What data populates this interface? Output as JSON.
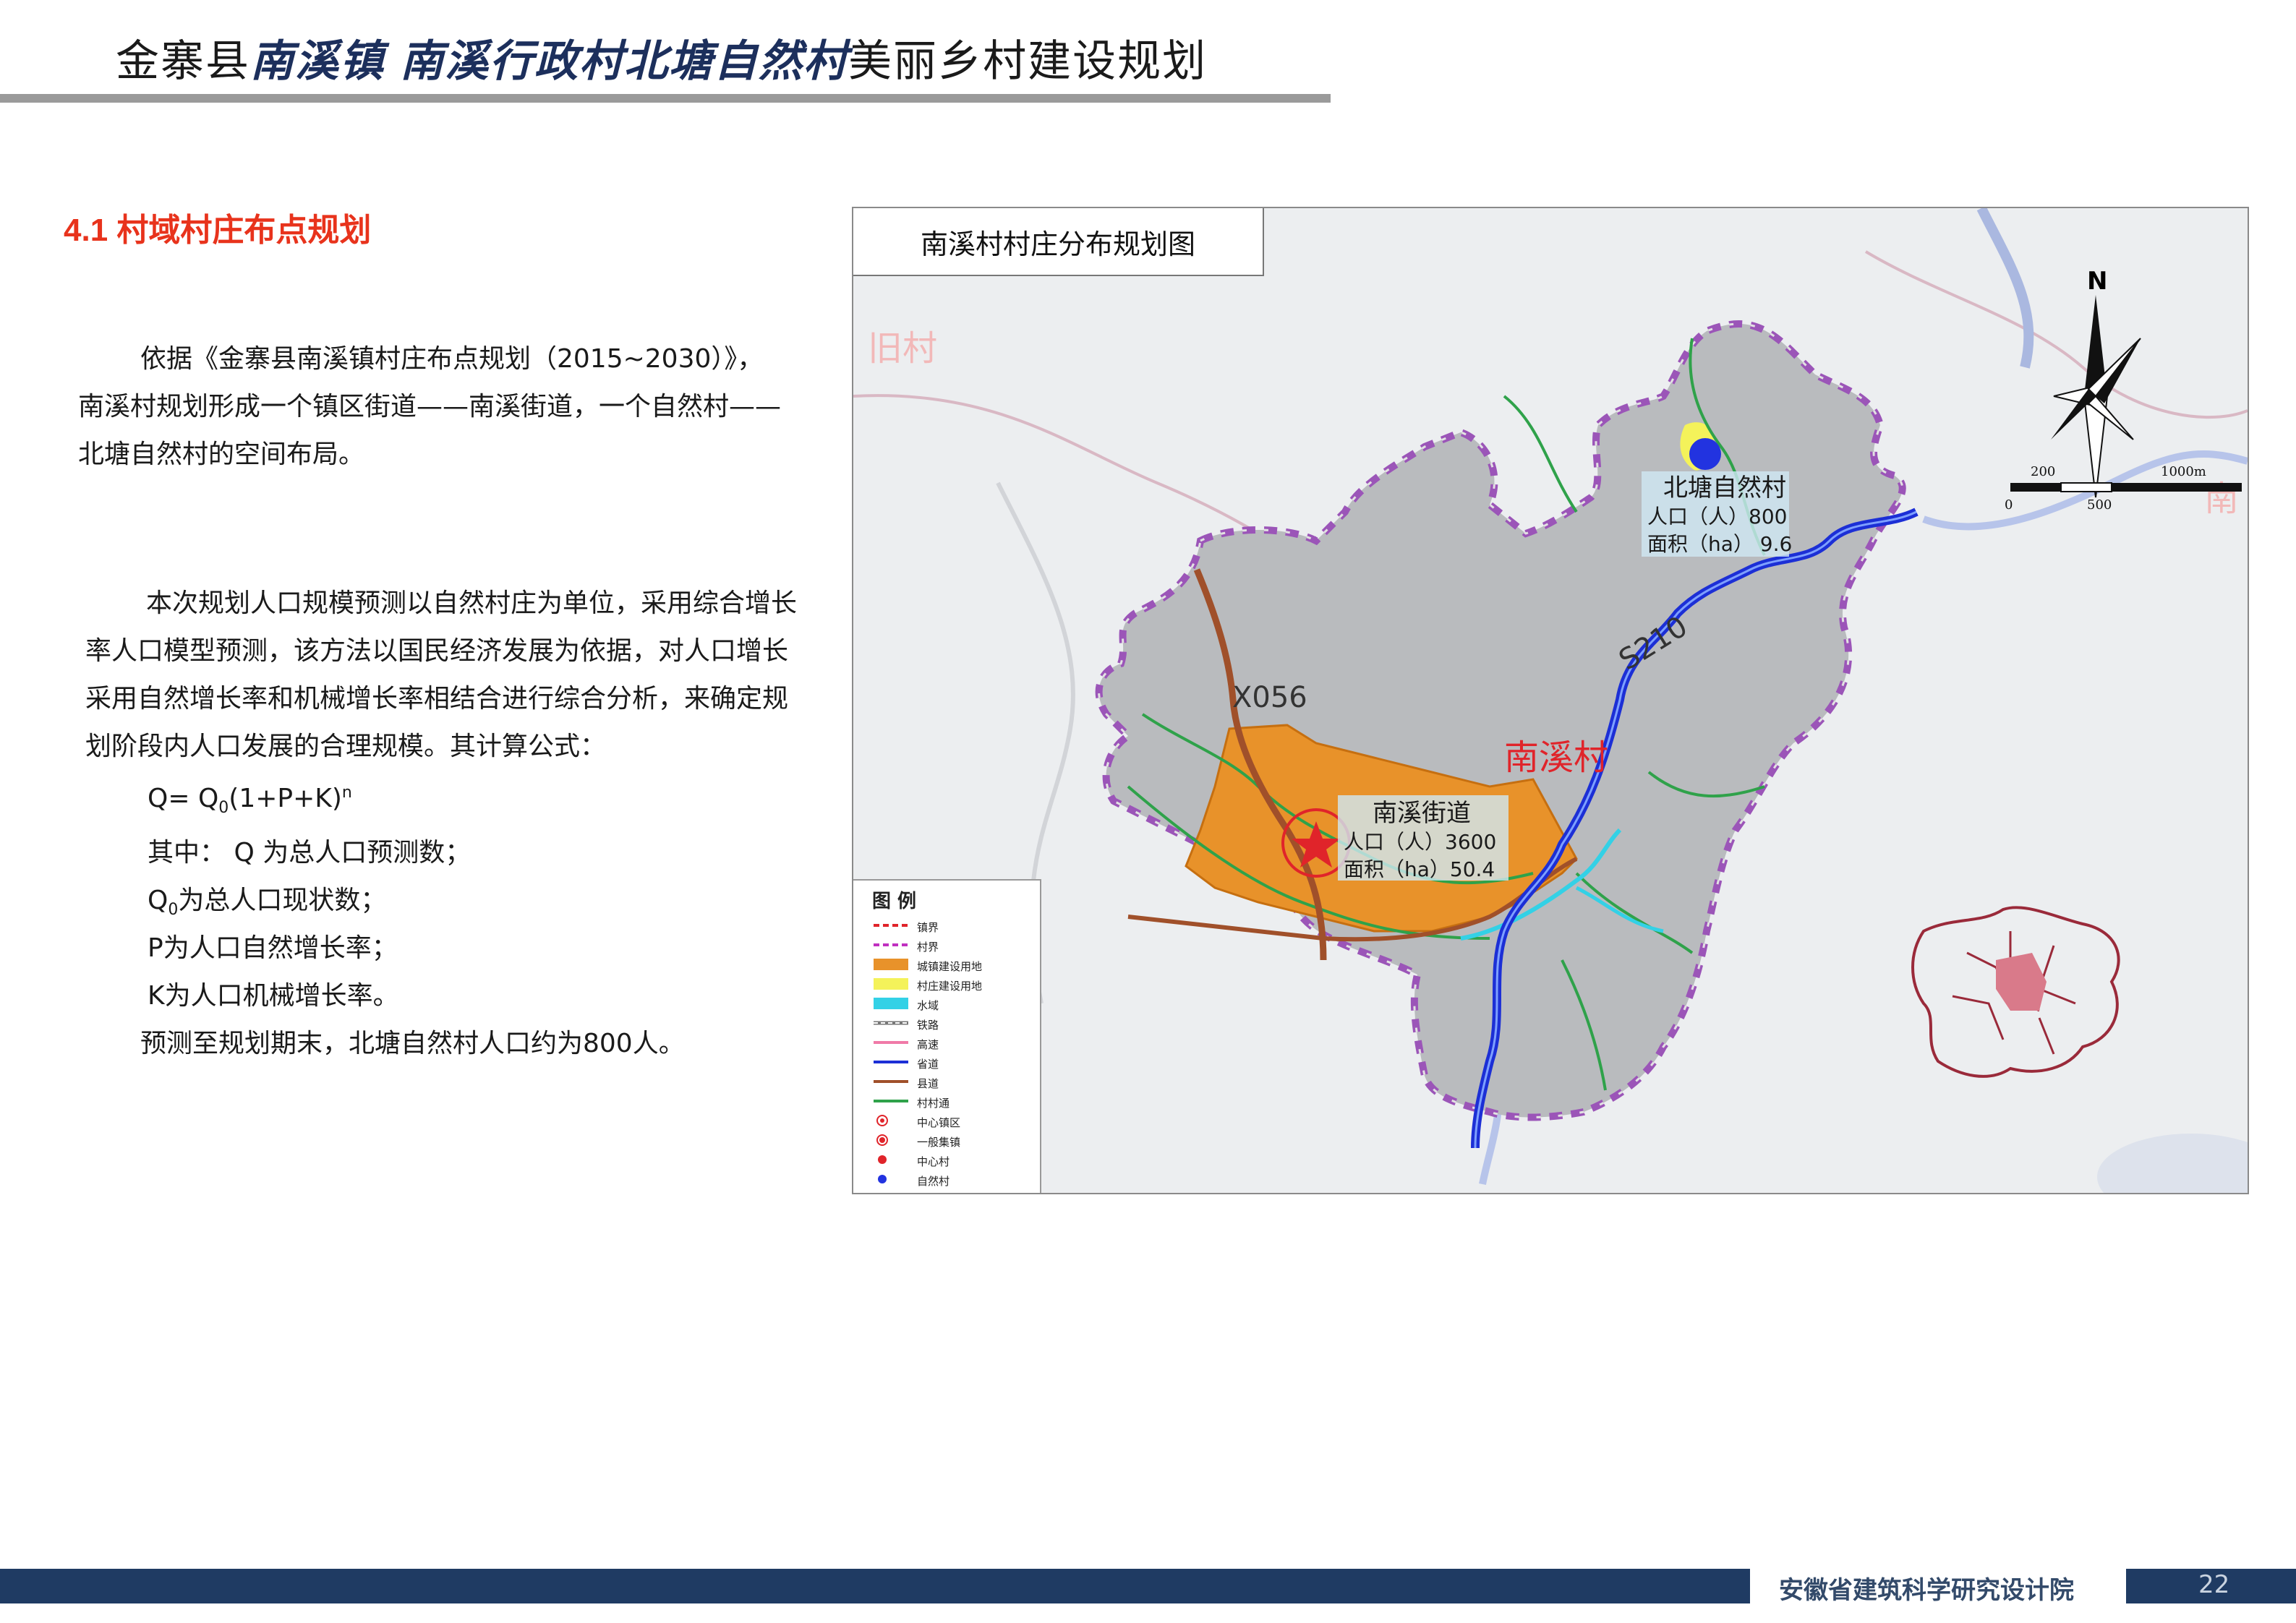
{
  "header": {
    "title_prefix": "金寨县",
    "title_hl1": "南溪镇",
    "title_hl2": "南溪行政村北塘自然村",
    "title_suffix": "美丽乡村建设规划"
  },
  "section": {
    "title": "4.1 村域村庄布点规划"
  },
  "body": {
    "para1": [
      "依据《金寨县南溪镇村庄布点规划（2015~2030）》，",
      "南溪村规划形成一个镇区街道——南溪街道，一个自然村——",
      "北塘自然村的空间布局。"
    ],
    "para2": [
      "本次规划人口规模预测以自然村庄为单位，采用综合增长",
      "率人口模型预测，该方法以国民经济发展为依据，对人口增长",
      "采用自然增长率和机械增长率相结合进行综合分析，来确定规",
      "划阶段内人口发展的合理规模。其计算公式："
    ],
    "formula": {
      "lhs": "Q= Q",
      "sub": "0",
      "mid": "(1+P+K)",
      "sup": "n"
    },
    "defs": {
      "q": "其中： Q 为总人口预测数；",
      "q0_pre": "Q",
      "q0_sub": "0",
      "q0_post": "为总人口现状数；",
      "p": "P为人口自然增长率；",
      "k": "K为人口机械增长率。",
      "conclusion": "预测至规划期末，北塘自然村人口约为800人。"
    }
  },
  "map": {
    "title": "南溪村村庄分布规划图",
    "village_label": "南溪村",
    "road_x": "X056",
    "road_s": "S210",
    "north": "N",
    "scale": {
      "t1": "200",
      "t2": "1000m",
      "b1": "0",
      "b2": "500"
    },
    "beitang": {
      "name": "北塘自然村",
      "pop": "人口（人）800",
      "area": "面积（ha） 9.6"
    },
    "nanxi_street": {
      "name": "南溪街道",
      "pop": "人口（人）3600",
      "area": "面积（ha）50.4"
    },
    "bg_text_left": "旧村",
    "bg_text_right": "南",
    "legend": {
      "title": "图 例",
      "items": [
        {
          "label": "镇界",
          "sym": "dash-red"
        },
        {
          "label": "村界",
          "sym": "dash-magenta"
        },
        {
          "label": "城镇建设用地",
          "sym": "fill-orange"
        },
        {
          "label": "村庄建设用地",
          "sym": "fill-yellow"
        },
        {
          "label": "水域",
          "sym": "fill-cyan"
        },
        {
          "label": "铁路",
          "sym": "rail"
        },
        {
          "label": "高速",
          "sym": "line-pink"
        },
        {
          "label": "省道",
          "sym": "line-blue"
        },
        {
          "label": "县道",
          "sym": "line-brown"
        },
        {
          "label": "村村通",
          "sym": "line-green"
        },
        {
          "label": "中心镇区",
          "sym": "ring-red-dot"
        },
        {
          "label": "一般集镇",
          "sym": "ring-red-dot2"
        },
        {
          "label": "中心村",
          "sym": "dot-red"
        },
        {
          "label": "自然村",
          "sym": "dot-blue"
        }
      ]
    }
  },
  "footer": {
    "org": "安徽省建筑科学研究设计院",
    "page": "22"
  },
  "colors": {
    "accent_red": "#e8331c",
    "navy": "#1f3b63",
    "province_road": "#1c2fd6",
    "county_road": "#a0502a",
    "town_land": "#e8922a"
  }
}
